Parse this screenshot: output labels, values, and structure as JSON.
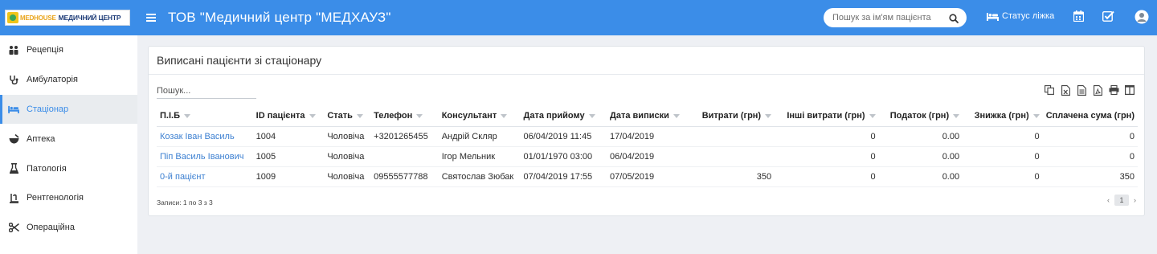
{
  "app": {
    "logo_word": "MEDHOUSE",
    "logo_text": "МЕДИЧНИЙ ЦЕНТР",
    "org_title": "ТОВ \"Медичний центр \"МЕДХАУЗ\"",
    "search_placeholder": "Пошук за ім'ям пацієнта",
    "bed_status_label": "Статус ліжка",
    "accent_color": "#3b8de8"
  },
  "sidebar": {
    "items": [
      {
        "label": "Рецепція",
        "icon": "group-icon",
        "active": false
      },
      {
        "label": "Амбулаторія",
        "icon": "stethoscope-icon",
        "active": false
      },
      {
        "label": "Стаціонар",
        "icon": "bed-icon",
        "active": true
      },
      {
        "label": "Аптека",
        "icon": "mortar-icon",
        "active": false
      },
      {
        "label": "Патологія",
        "icon": "flask-icon",
        "active": false
      },
      {
        "label": "Рентгенологія",
        "icon": "xray-icon",
        "active": false
      },
      {
        "label": "Операційна",
        "icon": "scissors-icon",
        "active": false
      }
    ]
  },
  "card": {
    "title": "Виписані пацієнти зі стаціонару",
    "search_placeholder": "Пошук...",
    "toolbar_icons": [
      "copy-icon",
      "excel-icon",
      "csv-icon",
      "pdf-icon",
      "print-icon",
      "columns-icon"
    ],
    "columns": [
      {
        "label": "П.І.Б",
        "align": "left"
      },
      {
        "label": "ID пацієнта",
        "align": "left"
      },
      {
        "label": "Стать",
        "align": "left"
      },
      {
        "label": "Телефон",
        "align": "left"
      },
      {
        "label": "Консультант",
        "align": "left"
      },
      {
        "label": "Дата прийому",
        "align": "left"
      },
      {
        "label": "Дата виписки",
        "align": "left"
      },
      {
        "label": "Витрати (грн)",
        "align": "right"
      },
      {
        "label": "Інші витрати (грн)",
        "align": "right"
      },
      {
        "label": "Податок (грн)",
        "align": "right"
      },
      {
        "label": "Знижка (грн)",
        "align": "right"
      },
      {
        "label": "Сплачена сума (грн)",
        "align": "right"
      }
    ],
    "rows": [
      [
        "Козак Іван Василь",
        "1004",
        "Чоловіча",
        "+3201265455",
        "Андрій Скляр",
        "06/04/2019 11:45",
        "17/04/2019",
        "",
        "0",
        "0.00",
        "0",
        "0"
      ],
      [
        "Піп Василь Іванович",
        "1005",
        "Чоловіча",
        "",
        "Ігор Мельник",
        "01/01/1970 03:00",
        "06/04/2019",
        "",
        "0",
        "0.00",
        "0",
        "0"
      ],
      [
        "0-й пацієнт",
        "1009",
        "Чоловіча",
        "09555577788",
        "Святослав Зюбак",
        "07/04/2019 17:55",
        "07/05/2019",
        "350",
        "0",
        "0.00",
        "0",
        "350"
      ]
    ],
    "records_info": "Записи: 1 по 3 з 3",
    "pagination": {
      "prev": "‹",
      "current": "1",
      "next": "›"
    }
  }
}
